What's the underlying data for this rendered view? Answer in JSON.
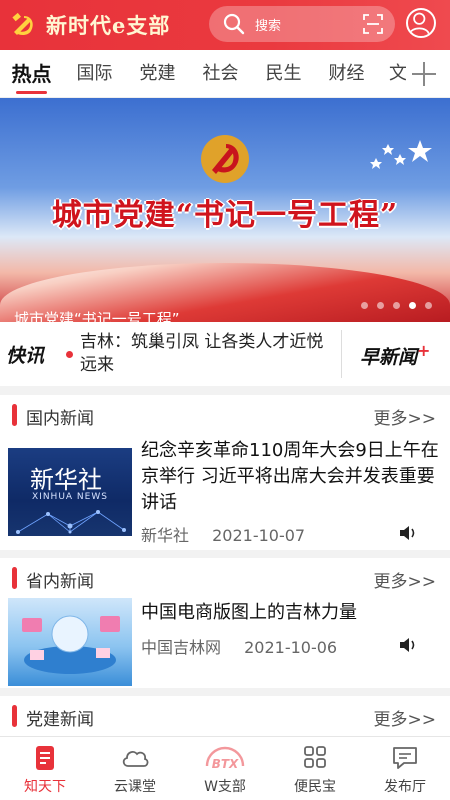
{
  "header": {
    "app_title": "新时代e支部",
    "search_placeholder": "搜索",
    "brand_color": "#e8323a"
  },
  "tabs": [
    {
      "label": "热点",
      "active": true
    },
    {
      "label": "国际"
    },
    {
      "label": "党建"
    },
    {
      "label": "社会"
    },
    {
      "label": "民生"
    },
    {
      "label": "财经"
    },
    {
      "label": "文"
    }
  ],
  "banner": {
    "title": "城市党建“书记一号工程”",
    "caption": "城市党建“书记一号工程”",
    "slide_count": 5,
    "active_slide": 4
  },
  "flash": {
    "label": "快讯",
    "text": "吉林：筑巢引凤 让各类人才近悦远来",
    "morning_news": "早新闻",
    "morning_plus": "+"
  },
  "sections": [
    {
      "title": "国内新闻",
      "more": "更多>>",
      "item": {
        "title": "纪念辛亥革命110周年大会9日上午在京举行 习近平将出席大会并发表重要讲话",
        "source": "新华社",
        "date": "2021-10-07",
        "thumb_text": "新华社",
        "thumb_sub": "XINHUA NEWS"
      }
    },
    {
      "title": "省内新闻",
      "more": "更多>>",
      "item": {
        "title": "中国电商版图上的吉林力量",
        "source": "中国吉林网",
        "date": "2021-10-06"
      }
    },
    {
      "title": "党建新闻",
      "more": "更多>>"
    }
  ],
  "bottom_nav": [
    {
      "label": "知天下",
      "icon": "news-icon",
      "active": true
    },
    {
      "label": "云课堂",
      "icon": "cloud-icon"
    },
    {
      "label": "W支部",
      "icon": "btx-icon",
      "icon_text": "BTX"
    },
    {
      "label": "便民宝",
      "icon": "grid-icon"
    },
    {
      "label": "发布厅",
      "icon": "message-icon"
    }
  ]
}
